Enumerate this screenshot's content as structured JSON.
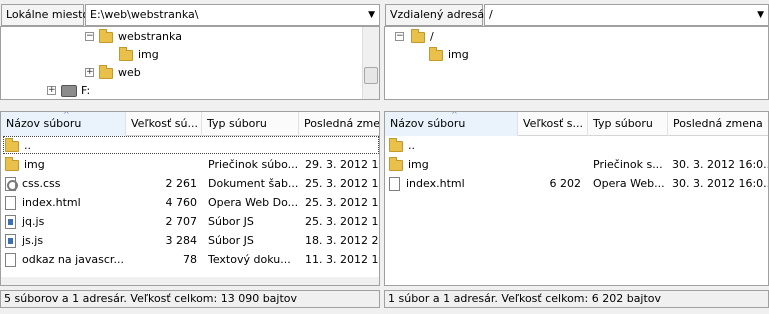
{
  "local": {
    "path_label": "Lokálne miesto:",
    "path_value": "E:\\web\\webstranka\\",
    "tree": [
      {
        "label": "webstranka",
        "expander": "−"
      },
      {
        "label": "img",
        "expander": ""
      },
      {
        "label": "web",
        "expander": "+"
      },
      {
        "label": "F:",
        "expander": "+"
      }
    ],
    "columns": [
      "Názov súboru",
      "Veľkosť sú...",
      "Typ súboru",
      "Posledná zme"
    ],
    "files": [
      {
        "icon": "folder-up-icon",
        "name": "..",
        "size": "",
        "type": "",
        "modified": ""
      },
      {
        "icon": "folder-icon",
        "name": "img",
        "size": "",
        "type": "Priečinok súbo...",
        "modified": "29. 3. 2012 16:..."
      },
      {
        "icon": "css-file-icon",
        "name": "css.css",
        "size": "2 261",
        "type": "Dokument šab...",
        "modified": "25. 3. 2012 10:..."
      },
      {
        "icon": "file-icon",
        "name": "index.html",
        "size": "4 760",
        "type": "Opera Web Do...",
        "modified": "25. 3. 2012 16:..."
      },
      {
        "icon": "js-file-icon",
        "name": "jq.js",
        "size": "2 707",
        "type": "Súbor JS",
        "modified": "25. 3. 2012 11:..."
      },
      {
        "icon": "js-file-icon",
        "name": "js.js",
        "size": "3 284",
        "type": "Súbor JS",
        "modified": "18. 3. 2012 22:..."
      },
      {
        "icon": "file-icon",
        "name": "odkaz na javascr...",
        "size": "78",
        "type": "Textový doku...",
        "modified": "11. 3. 2012 19:..."
      }
    ],
    "status": "5 súborov a 1 adresár. Veľkosť celkom: 13 090 bajtov"
  },
  "remote": {
    "path_label": "Vzdialený adresár:",
    "path_value": "/",
    "tree": [
      {
        "label": "/",
        "expander": "−"
      },
      {
        "label": "img",
        "expander": ""
      }
    ],
    "columns": [
      "Názov súboru",
      "Veľkosť s...",
      "Typ súboru",
      "Posledná zmena"
    ],
    "files": [
      {
        "icon": "folder-up-icon",
        "name": "..",
        "size": "",
        "type": "",
        "modified": ""
      },
      {
        "icon": "folder-icon",
        "name": "img",
        "size": "",
        "type": "Priečinok s...",
        "modified": "30. 3. 2012 16:0..."
      },
      {
        "icon": "file-icon",
        "name": "index.html",
        "size": "6 202",
        "type": "Opera Web...",
        "modified": "30. 3. 2012 16:0..."
      }
    ],
    "status": "1 súbor a 1 adresár. Veľkosť celkom: 6 202 bajtov"
  }
}
